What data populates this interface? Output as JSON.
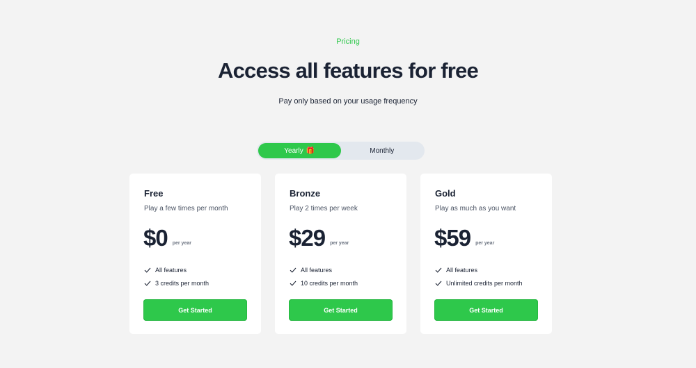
{
  "header": {
    "eyebrow": "Pricing",
    "title": "Access all features for free",
    "subtitle": "Pay only based on your usage frequency"
  },
  "billing_toggle": {
    "options": [
      "Yearly",
      "Monthly"
    ],
    "selected": "Yearly",
    "gift_icon": "🎁"
  },
  "colors": {
    "accent": "#2ec84b",
    "background": "#f3f3f3",
    "card": "#ffffff",
    "toggle_track": "#e3e8ee",
    "text": "#1a2233"
  },
  "plans": [
    {
      "name": "Free",
      "description": "Play a few times per month",
      "price": "$0",
      "period": "per year",
      "features": [
        "All features",
        "3 credits per month"
      ],
      "cta": "Get Started"
    },
    {
      "name": "Bronze",
      "description": "Play 2 times per week",
      "price": "$29",
      "period": "per year",
      "features": [
        "All features",
        "10 credits per month"
      ],
      "cta": "Get Started"
    },
    {
      "name": "Gold",
      "description": "Play as much as you want",
      "price": "$59",
      "period": "per year",
      "features": [
        "All features",
        "Unlimited credits per month"
      ],
      "cta": "Get Started"
    }
  ],
  "icons": {
    "feature": "check-icon",
    "gift": "gift-icon"
  }
}
